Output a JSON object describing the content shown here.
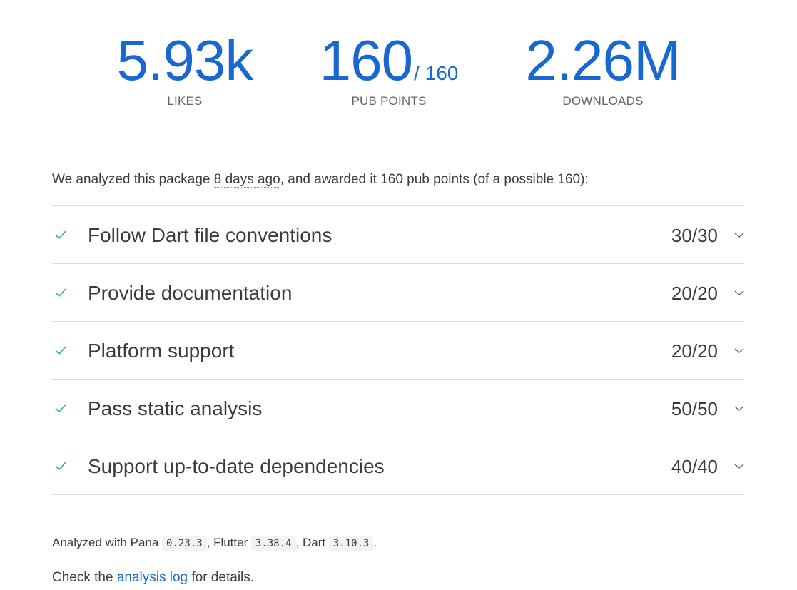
{
  "scores": {
    "likes": {
      "value": "5.93k",
      "label": "LIKES"
    },
    "points": {
      "value": "160",
      "suffix": "/ 160",
      "label": "PUB POINTS"
    },
    "downloads": {
      "value": "2.26M",
      "label": "DOWNLOADS"
    }
  },
  "summary": {
    "prefix": "We analyzed this package ",
    "time_ago": "8 days ago",
    "suffix": ", and awarded it 160 pub points (of a possible 160):"
  },
  "sections": [
    {
      "title": "Follow Dart file conventions",
      "score": "30/30",
      "status": "passed"
    },
    {
      "title": "Provide documentation",
      "score": "20/20",
      "status": "passed"
    },
    {
      "title": "Platform support",
      "score": "20/20",
      "status": "passed"
    },
    {
      "title": "Pass static analysis",
      "score": "50/50",
      "status": "passed"
    },
    {
      "title": "Support up-to-date dependencies",
      "score": "40/40",
      "status": "passed"
    }
  ],
  "analyzed_with": {
    "prefix": "Analyzed with Pana ",
    "pana_version": "0.23.3",
    "flutter_label": ", Flutter ",
    "flutter_version": "3.38.4",
    "dart_label": ", Dart ",
    "dart_version": "3.10.3",
    "end": "."
  },
  "log_note": {
    "prefix": "Check the ",
    "link": "analysis log",
    "suffix": " for details."
  },
  "colors": {
    "accent": "#1967d2",
    "check": "#2bb673",
    "divider": "#dadce0"
  },
  "icons": {
    "check": "check-icon",
    "chevron": "chevron-down-icon"
  }
}
